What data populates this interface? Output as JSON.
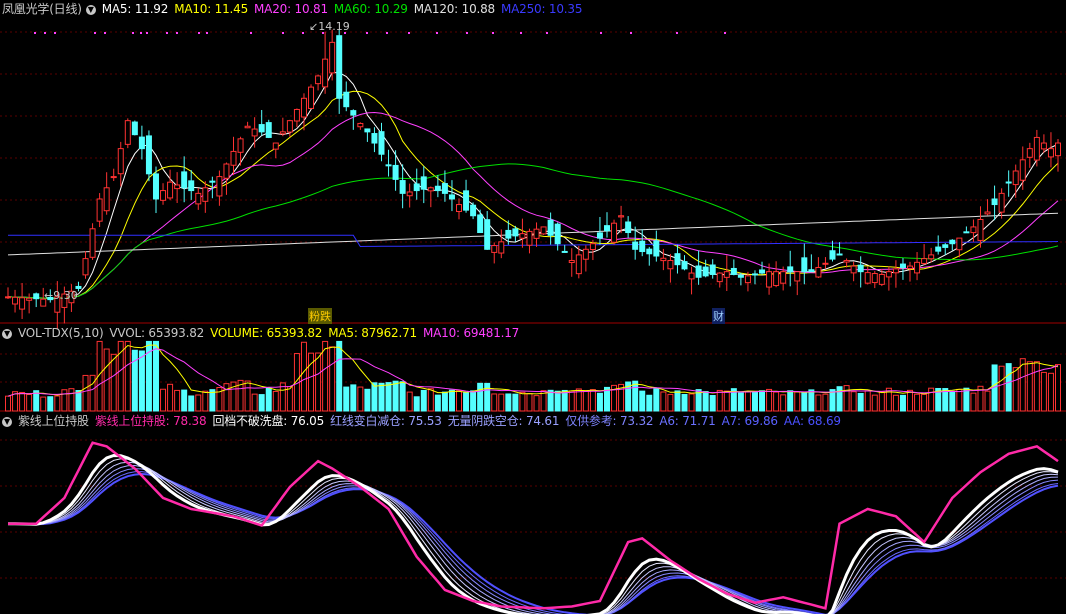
{
  "colors": {
    "bg": "#000000",
    "frame": "#a00000",
    "grid": "#5a0000",
    "up": "#ff3232",
    "down": "#54ffff",
    "ma5": "#ffffff",
    "ma10": "#ffff00",
    "ma20": "#ff40ff",
    "ma60": "#00e000",
    "ma120": "#e0e0e0",
    "ma250": "#3030ff",
    "pink": "#ff2aa8",
    "white": "#ffffff",
    "blue": "#5050ff"
  },
  "main_header": {
    "title": "凤凰光学(日线)",
    "ma5": "MA5: 11.92",
    "ma10": "MA10: 11.45",
    "ma20": "MA20: 10.81",
    "ma60": "MA60: 10.29",
    "ma120": "MA120: 10.88",
    "ma250": "MA250: 10.35"
  },
  "vol_header": {
    "name": "VOL-TDX(5,10)",
    "vvol": "VVOL: 65393.82",
    "volume": "VOLUME: 65393.82",
    "ma5": "MA5: 87962.71",
    "ma10": "MA10: 69481.17"
  },
  "ind_header": {
    "name": "紫线上位持股",
    "l1": "紫线上位持股: 78.38",
    "l2": "回档不破洗盘: 76.05",
    "l3": "红线变白减仓: 75.53",
    "l4": "无量阴跌空仓: 74.61",
    "l5": "仅供参考: 73.32",
    "a6": "A6: 71.71",
    "a7": "A7: 69.86",
    "aa": "AA: 68.69"
  },
  "annotations": {
    "high": "14.19",
    "low": "9.30",
    "tag1": "粉跌",
    "tag2": "财"
  },
  "chart_data": [
    {
      "type": "candlestick",
      "title": "凤凰光学(日线)",
      "x_count": 150,
      "ylim": [
        9.0,
        14.4
      ],
      "ma_series": [
        {
          "name": "MA5",
          "last": 11.92
        },
        {
          "name": "MA10",
          "last": 11.45
        },
        {
          "name": "MA20",
          "last": 10.81
        },
        {
          "name": "MA60",
          "last": 10.29
        },
        {
          "name": "MA120",
          "last": 10.88
        },
        {
          "name": "MA250",
          "last": 10.35
        }
      ],
      "close_keypoints": [
        [
          0,
          9.45
        ],
        [
          6,
          9.4
        ],
        [
          8,
          9.5
        ],
        [
          10,
          9.6
        ],
        [
          13,
          11.2
        ],
        [
          15,
          11.6
        ],
        [
          17,
          12.6
        ],
        [
          19,
          12.1
        ],
        [
          21,
          11.2
        ],
        [
          23,
          11.5
        ],
        [
          27,
          11.3
        ],
        [
          30,
          11.6
        ],
        [
          34,
          12.5
        ],
        [
          36,
          12.4
        ],
        [
          38,
          12.2
        ],
        [
          42,
          13.0
        ],
        [
          44,
          13.4
        ],
        [
          46,
          14.0
        ],
        [
          47,
          13.0
        ],
        [
          49,
          12.7
        ],
        [
          51,
          12.4
        ],
        [
          54,
          11.8
        ],
        [
          56,
          11.3
        ],
        [
          60,
          11.4
        ],
        [
          62,
          11.3
        ],
        [
          66,
          10.9
        ],
        [
          68,
          10.3
        ],
        [
          71,
          10.5
        ],
        [
          76,
          10.7
        ],
        [
          80,
          10.1
        ],
        [
          84,
          10.5
        ],
        [
          87,
          10.9
        ],
        [
          89,
          10.3
        ],
        [
          94,
          10.1
        ],
        [
          98,
          9.8
        ],
        [
          102,
          9.9
        ],
        [
          104,
          9.8
        ],
        [
          108,
          9.9
        ],
        [
          114,
          9.9
        ],
        [
          118,
          10.2
        ],
        [
          121,
          9.9
        ],
        [
          124,
          9.85
        ],
        [
          126,
          9.95
        ],
        [
          128,
          10.0
        ],
        [
          131,
          10.2
        ],
        [
          134,
          10.4
        ],
        [
          137,
          10.7
        ],
        [
          140,
          11.1
        ],
        [
          143,
          11.7
        ],
        [
          146,
          12.3
        ],
        [
          148,
          12.1
        ],
        [
          149,
          12.2
        ]
      ],
      "highlights": [
        {
          "label": "14.19",
          "x": 45,
          "value": 14.19,
          "kind": "max"
        },
        {
          "label": "9.30",
          "x": 5,
          "value": 9.3,
          "kind": "min"
        }
      ],
      "markers": [
        {
          "label": "粉跌",
          "x": 44
        },
        {
          "label": "财",
          "x": 102
        }
      ]
    },
    {
      "type": "bar",
      "title": "VOL-TDX(5,10)",
      "ylim": [
        0,
        100000
      ],
      "values_note": "VOLUME 65393.82",
      "last": {
        "VOLUME": 65393.82,
        "MA5": 87962.71,
        "MA10": 69481.17
      }
    },
    {
      "type": "line",
      "title": "紫线上位持股",
      "ylim": [
        0,
        100
      ],
      "series": [
        {
          "name": "紫线上位持股",
          "last": 78.38
        },
        {
          "name": "回档不破洗盘",
          "last": 76.05
        },
        {
          "name": "红线变白减仓",
          "last": 75.53
        },
        {
          "name": "无量阴跌空仓",
          "last": 74.61
        },
        {
          "name": "仅供参考",
          "last": 73.32
        },
        {
          "name": "A6",
          "last": 71.71
        },
        {
          "name": "A7",
          "last": 69.86
        },
        {
          "name": "AA",
          "last": 68.69
        }
      ]
    }
  ]
}
